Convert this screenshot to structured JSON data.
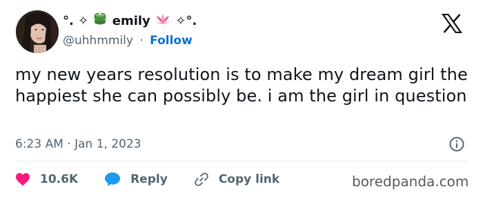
{
  "author": {
    "name_prefix": "°. ✧",
    "name": "emily",
    "name_suffix": "✧°.",
    "handle": "@uhhmmily",
    "separator": "·",
    "follow_label": "Follow"
  },
  "tweet": {
    "text": "my new years resolution is to make my dream girl the happiest she can possibly be. i am the girl in question",
    "time": "6:23 AM",
    "separator": "·",
    "date": "Jan 1, 2023"
  },
  "actions": {
    "likes": "10.6K",
    "reply_label": "Reply",
    "copy_link_label": "Copy link"
  },
  "icons": {
    "like": "heart-icon",
    "reply": "speech-bubble-icon",
    "copy": "link-icon",
    "info": "info-icon",
    "brand": "x-logo-icon"
  },
  "colors": {
    "like": "#f91880",
    "reply": "#1d9bf0",
    "follow": "#0a72c9",
    "muted": "#536471"
  },
  "watermark": "boredpanda.com"
}
